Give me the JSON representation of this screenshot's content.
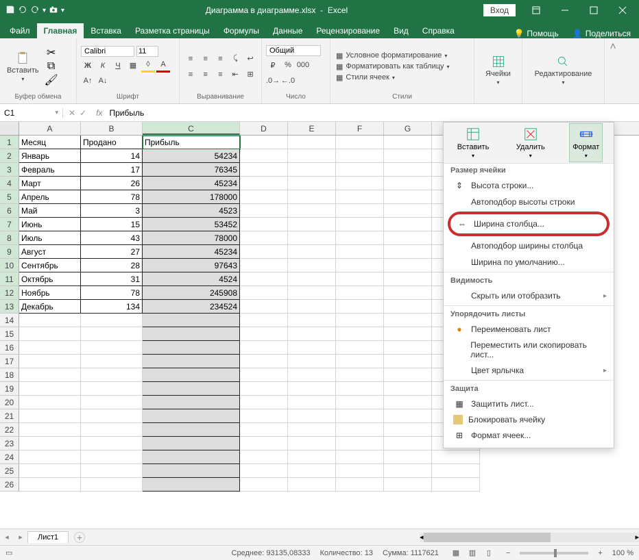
{
  "title": {
    "filename": "Диаграмма в диаграмме.xlsx",
    "app": "Excel",
    "signin": "Вход"
  },
  "tabs": {
    "file": "Файл",
    "home": "Главная",
    "insert": "Вставка",
    "layout": "Разметка страницы",
    "formulas": "Формулы",
    "data": "Данные",
    "review": "Рецензирование",
    "view": "Вид",
    "help": "Справка",
    "tellme": "Помощь",
    "share": "Поделиться"
  },
  "ribbon": {
    "clipboard": {
      "paste": "Вставить",
      "label": "Буфер обмена"
    },
    "font": {
      "name": "Calibri",
      "size": "11",
      "label": "Шрифт"
    },
    "align": {
      "label": "Выравнивание"
    },
    "number": {
      "format": "Общий",
      "label": "Число"
    },
    "styles": {
      "cond": "Условное форматирование",
      "table": "Форматировать как таблицу",
      "cell": "Стили ячеек",
      "label": "Стили"
    },
    "cells": {
      "btn": "Ячейки",
      "label": ""
    },
    "editing": {
      "btn": "Редактирование",
      "label": ""
    }
  },
  "namebox": "C1",
  "formula": "Прибыль",
  "columns": [
    "A",
    "B",
    "C",
    "D",
    "E",
    "F",
    "G",
    "H"
  ],
  "headers": {
    "A": "Месяц",
    "B": "Продано",
    "C": "Прибыль"
  },
  "rows": [
    {
      "n": 1,
      "A": "Месяц",
      "B": "Продано",
      "C": "Прибыль",
      "header": true
    },
    {
      "n": 2,
      "A": "Январь",
      "B": "14",
      "C": "54234"
    },
    {
      "n": 3,
      "A": "Февраль",
      "B": "17",
      "C": "76345"
    },
    {
      "n": 4,
      "A": "Март",
      "B": "26",
      "C": "45234"
    },
    {
      "n": 5,
      "A": "Апрель",
      "B": "78",
      "C": "178000"
    },
    {
      "n": 6,
      "A": "Май",
      "B": "3",
      "C": "4523"
    },
    {
      "n": 7,
      "A": "Июнь",
      "B": "15",
      "C": "53452"
    },
    {
      "n": 8,
      "A": "Июль",
      "B": "43",
      "C": "78000"
    },
    {
      "n": 9,
      "A": "Август",
      "B": "27",
      "C": "45234"
    },
    {
      "n": 10,
      "A": "Сентябрь",
      "B": "28",
      "C": "97643"
    },
    {
      "n": 11,
      "A": "Октябрь",
      "B": "31",
      "C": "4524"
    },
    {
      "n": 12,
      "A": "Ноябрь",
      "B": "78",
      "C": "245908"
    },
    {
      "n": 13,
      "A": "Декабрь",
      "B": "134",
      "C": "234524"
    }
  ],
  "blank_rows": [
    14,
    15,
    16,
    17,
    18,
    19,
    20,
    21,
    22,
    23,
    24,
    25,
    26
  ],
  "popup": {
    "insert": "Вставить",
    "delete": "Удалить",
    "format": "Формат",
    "sec_size": "Размер ячейки",
    "row_height": "Высота строки...",
    "autofit_row": "Автоподбор высоты строки",
    "col_width": "Ширина столбца...",
    "autofit_col": "Автоподбор ширины столбца",
    "default_width": "Ширина по умолчанию...",
    "sec_vis": "Видимость",
    "hide": "Скрыть или отобразить",
    "sec_org": "Упорядочить листы",
    "rename": "Переименовать лист",
    "move": "Переместить или скопировать лист...",
    "tabcolor": "Цвет ярлычка",
    "sec_prot": "Защита",
    "protect": "Защитить лист...",
    "lock": "Блокировать ячейку",
    "fmtcells": "Формат ячеек..."
  },
  "sheettab": "Лист1",
  "status": {
    "avg_label": "Среднее:",
    "avg": "93135,08333",
    "count_label": "Количество:",
    "count": "13",
    "sum_label": "Сумма:",
    "sum": "1117621",
    "zoom": "100 %"
  }
}
